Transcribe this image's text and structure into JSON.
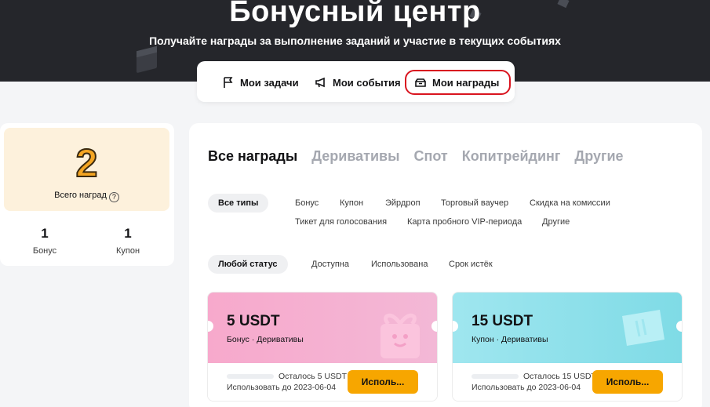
{
  "hero": {
    "title": "Бонусный центр",
    "subtitle": "Получайте награды за выполнение заданий и участие в текущих событиях"
  },
  "nav": {
    "items": [
      {
        "label": "Мои задачи",
        "icon": "flag-icon"
      },
      {
        "label": "Мои события",
        "icon": "megaphone-icon"
      },
      {
        "label": "Мои награды",
        "icon": "reward-box-icon",
        "active": true
      }
    ]
  },
  "summary": {
    "total": "2",
    "total_label": "Всего наград",
    "stats": [
      {
        "value": "1",
        "label": "Бонус"
      },
      {
        "value": "1",
        "label": "Купон"
      }
    ]
  },
  "tabs": [
    "Все награды",
    "Деривативы",
    "Спот",
    "Копитрейдинг",
    "Другие"
  ],
  "type_filters": {
    "selected": "Все типы",
    "options": [
      "Бонус",
      "Купон",
      "Эйрдроп",
      "Торговый ваучер",
      "Скидка на комиссии",
      "Тикет для голосования",
      "Карта пробного VIP-периода",
      "Другие"
    ]
  },
  "status_filters": {
    "selected": "Любой статус",
    "options": [
      "Доступна",
      "Использована",
      "Срок истёк"
    ]
  },
  "cards": [
    {
      "amount": "5 USDT",
      "type": "Бонус · Деривативы",
      "remaining": "Осталось 5 USDT",
      "use_until": "Использовать до 2023-06-04",
      "button": "Исполь...",
      "color": "#f5a6c9",
      "icon": "gift-box-icon"
    },
    {
      "amount": "15 USDT",
      "type": "Купон · Деривативы",
      "remaining": "Осталось 15 USDT",
      "use_until": "Использовать до 2023-06-04",
      "button": "Исполь...",
      "color": "#8fe3ec",
      "icon": "ticket-icon"
    }
  ],
  "colors": {
    "hero_bg": "#25262b",
    "accent": "#f7a600",
    "highlight_border": "#d9141f"
  }
}
